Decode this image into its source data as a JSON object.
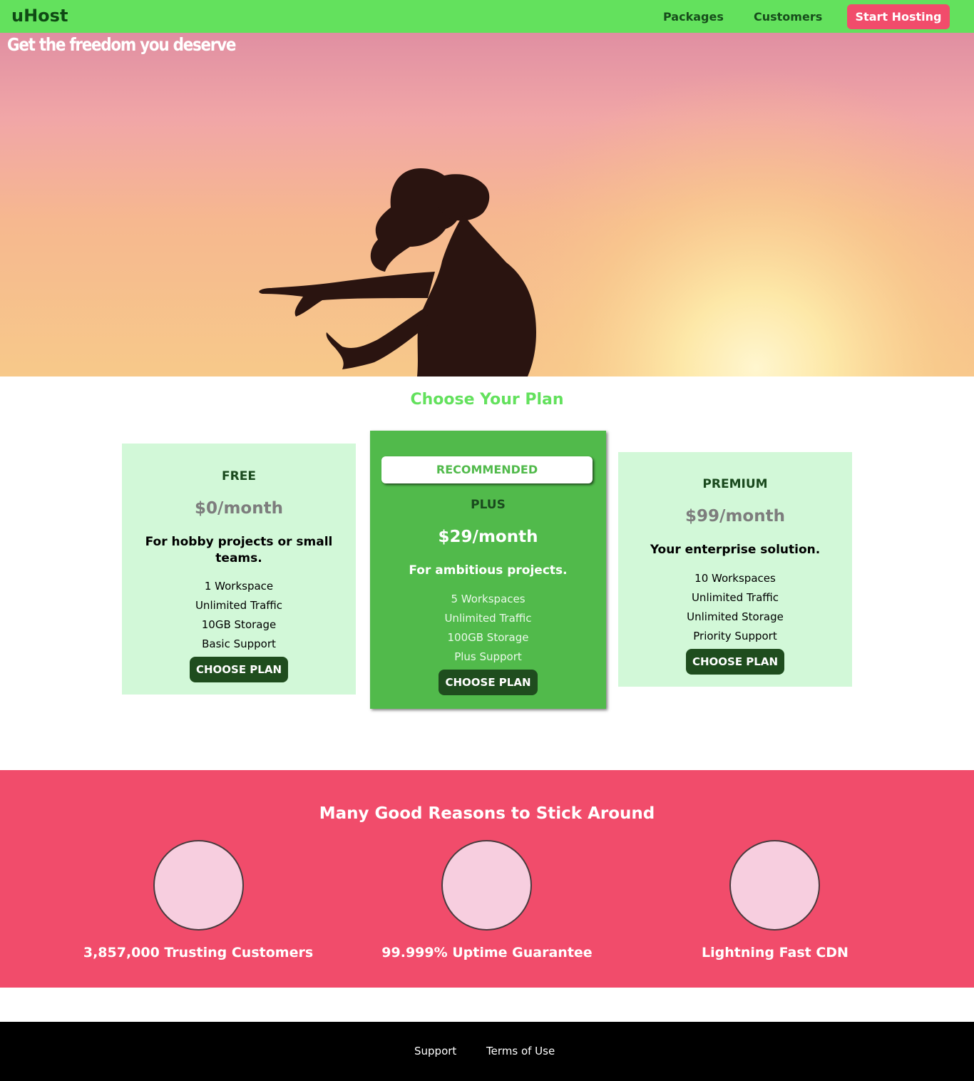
{
  "header": {
    "brand": "uHost",
    "nav": [
      {
        "label": "Packages"
      },
      {
        "label": "Customers"
      }
    ],
    "cta_label": "Start Hosting",
    "colors": {
      "bar": "#63e15d",
      "cta": "#f14c6b"
    }
  },
  "hero": {
    "title": "Get the freedom you deserve"
  },
  "plans": {
    "title": "Choose Your Plan",
    "items": [
      {
        "name": "FREE",
        "price": "$0/month",
        "summary": "For hobby projects or small teams.",
        "features": [
          "1 Workspace",
          "Unlimited Traffic",
          "10GB Storage",
          "Basic Support"
        ],
        "button": "CHOOSE PLAN"
      },
      {
        "badge": "RECOMMENDED",
        "name": "PLUS",
        "price": "$29/month",
        "summary": "For ambitious projects.",
        "features": [
          "5 Workspaces",
          "Unlimited Traffic",
          "100GB Storage",
          "Plus Support"
        ],
        "button": "CHOOSE PLAN"
      },
      {
        "name": "PREMIUM",
        "price": "$99/month",
        "summary": "Your enterprise solution.",
        "features": [
          "10 Workspaces",
          "Unlimited Traffic",
          "Unlimited Storage",
          "Priority Support"
        ],
        "button": "CHOOSE PLAN"
      }
    ]
  },
  "reasons": {
    "title": "Many Good Reasons to Stick Around",
    "items": [
      {
        "label": "3,857,000 Trusting Customers"
      },
      {
        "label": "99.999% Uptime Guarantee"
      },
      {
        "label": "Lightning Fast CDN"
      }
    ]
  },
  "footer": {
    "links": [
      {
        "label": "Support"
      },
      {
        "label": "Terms of Use"
      }
    ]
  }
}
